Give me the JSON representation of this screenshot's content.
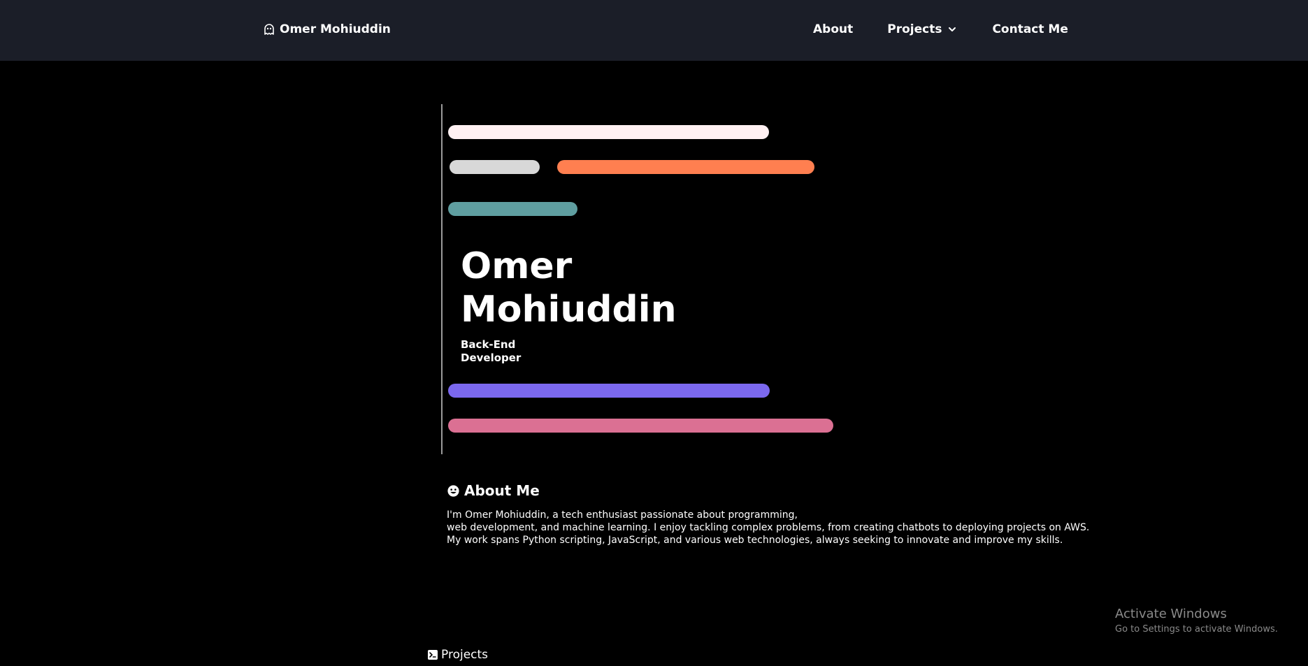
{
  "nav": {
    "brand": {
      "icon": "ghost-icon",
      "label": "Omer Mohiuddin"
    },
    "links": [
      {
        "label": "About"
      },
      {
        "label": "Projects",
        "icon": "chevron-down-icon"
      },
      {
        "label": "Contact Me"
      }
    ]
  },
  "hero": {
    "name": "Omer Mohiuddin",
    "role": "Back-End Developer",
    "colors": {
      "bar1": "#fff0f2",
      "bar2": "#d8d8d8",
      "bar3": "#ff7f50",
      "bar4": "#5f9ea0",
      "bar5": "#7b68ee",
      "bar6": "#db7093"
    }
  },
  "about": {
    "icon": "smile-icon",
    "heading": "About Me",
    "lines": [
      "I'm Omer Mohiuddin, a tech enthusiast passionate about programming,",
      "web development, and machine learning. I enjoy tackling complex problems, from creating chatbots to deploying projects on AWS.",
      "My work spans Python scripting, JavaScript, and various web technologies, always seeking to innovate and improve my skills."
    ]
  },
  "projects": {
    "icon": "terminal-icon",
    "label": "Projects"
  },
  "watermark": {
    "title": "Activate Windows",
    "subtitle": "Go to Settings to activate Windows."
  }
}
